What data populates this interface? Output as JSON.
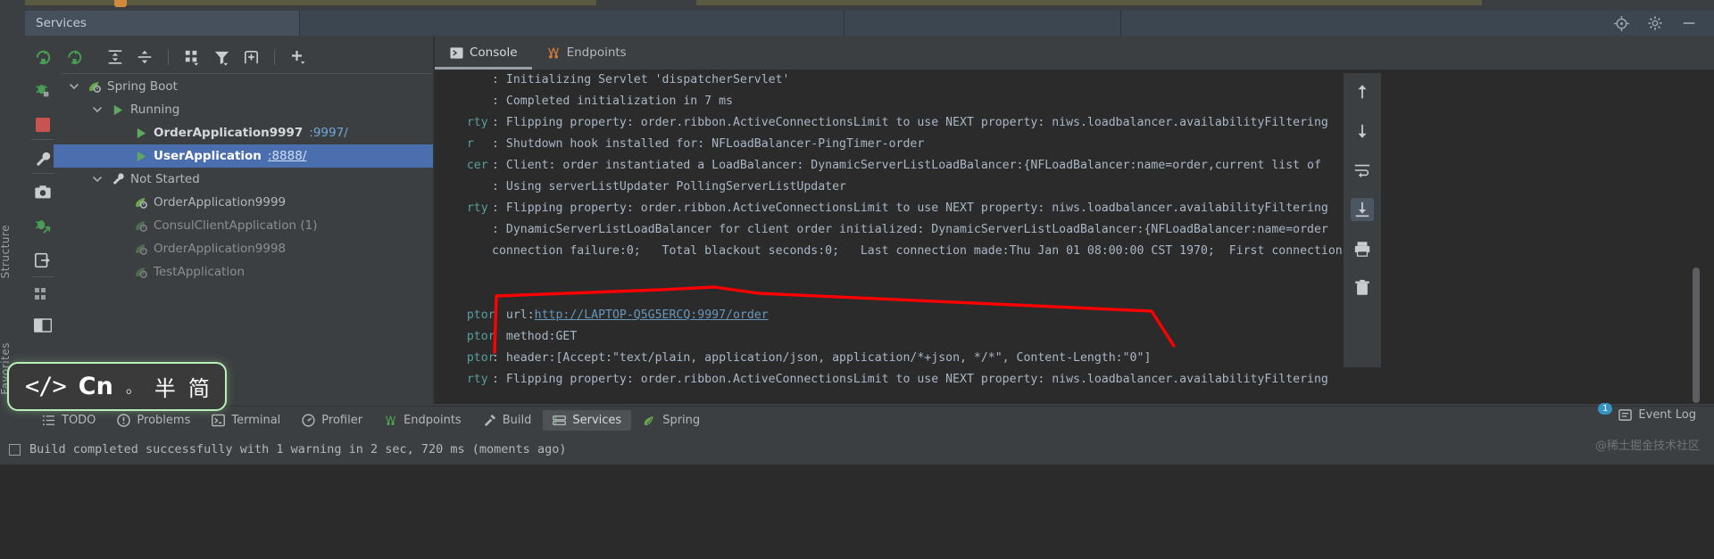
{
  "window": {
    "tab_title": "Services",
    "titlebar_icons": [
      "target-icon",
      "gear-icon",
      "minimize-icon"
    ]
  },
  "left_rail": {
    "structure_label": "Structure",
    "favorites_label": "Favorites"
  },
  "tree_toolbar": {
    "buttons": [
      {
        "name": "rerun-icon",
        "tooltip": "Rerun"
      },
      {
        "name": "expand-all-icon",
        "tooltip": "Expand All"
      },
      {
        "name": "collapse-all-icon",
        "tooltip": "Collapse All"
      },
      {
        "name": "group-by-icon",
        "tooltip": "Group By"
      },
      {
        "name": "filter-icon",
        "tooltip": "Filter"
      },
      {
        "name": "add-tab-icon",
        "tooltip": "Add Tab"
      },
      {
        "name": "add-icon",
        "tooltip": "Add Service"
      }
    ]
  },
  "side_icons": [
    {
      "name": "rerun-icon"
    },
    {
      "name": "debug-icon"
    },
    {
      "name": "stop-icon"
    },
    {
      "name": "settings-wrench-icon"
    },
    {
      "name": "camera-icon"
    },
    {
      "name": "debug-attach-icon"
    },
    {
      "name": "export-icon"
    },
    {
      "name": "layout-icon"
    },
    {
      "name": "window-icon"
    }
  ],
  "tree": {
    "nodes": [
      {
        "label": "Spring Boot",
        "icon": "spring-leaf-icon",
        "indent": 0,
        "expanded": true,
        "selected": false,
        "bold": false,
        "port": ""
      },
      {
        "label": "Running",
        "icon": "run-green-triangle-icon",
        "indent": 1,
        "expanded": true,
        "selected": false,
        "bold": false,
        "port": ""
      },
      {
        "label": "OrderApplication9997",
        "icon": "run-green-triangle-icon",
        "indent": 2,
        "expanded": null,
        "selected": false,
        "bold": true,
        "port": ":9997/"
      },
      {
        "label": "UserApplication",
        "icon": "run-green-triangle-icon",
        "indent": 2,
        "expanded": null,
        "selected": true,
        "bold": true,
        "port": ":8888/"
      },
      {
        "label": "Not Started",
        "icon": "wrench-icon",
        "indent": 1,
        "expanded": true,
        "selected": false,
        "bold": false,
        "port": ""
      },
      {
        "label": "OrderApplication9999",
        "icon": "spring-leaf-icon",
        "indent": 2,
        "expanded": null,
        "selected": false,
        "bold": false,
        "port": ""
      },
      {
        "label": "ConsulClientApplication (1)",
        "icon": "spring-leaf-dim-icon",
        "indent": 2,
        "expanded": null,
        "selected": false,
        "bold": false,
        "port": ""
      },
      {
        "label": "OrderApplication9998",
        "icon": "spring-leaf-dim-icon",
        "indent": 2,
        "expanded": null,
        "selected": false,
        "bold": false,
        "port": ""
      },
      {
        "label": "TestApplication",
        "icon": "spring-leaf-dim-icon",
        "indent": 2,
        "expanded": null,
        "selected": false,
        "bold": false,
        "port": ""
      }
    ]
  },
  "console": {
    "tabs": [
      {
        "label": "Console",
        "icon": "console-icon",
        "active": true
      },
      {
        "label": "Endpoints",
        "icon": "endpoints-icon",
        "active": false
      }
    ],
    "lines": [
      {
        "prefix": "",
        "text": ": Initializing Servlet 'dispatcherServlet'"
      },
      {
        "prefix": "",
        "text": ": Completed initialization in 7 ms"
      },
      {
        "prefix": "rty",
        "text": ": Flipping property: order.ribbon.ActiveConnectionsLimit to use NEXT property: niws.loadbalancer.availabilityFiltering"
      },
      {
        "prefix": "r",
        "text": ": Shutdown hook installed for: NFLoadBalancer-PingTimer-order"
      },
      {
        "prefix": "cer",
        "text": ": Client: order instantiated a LoadBalancer: DynamicServerListLoadBalancer:{NFLoadBalancer:name=order,current list of"
      },
      {
        "prefix": "",
        "text": ": Using serverListUpdater PollingServerListUpdater"
      },
      {
        "prefix": "rty",
        "text": ": Flipping property: order.ribbon.ActiveConnectionsLimit to use NEXT property: niws.loadbalancer.availabilityFiltering"
      },
      {
        "prefix": "",
        "text": ": DynamicServerListLoadBalancer for client order initialized: DynamicServerListLoadBalancer:{NFLoadBalancer:name=order"
      },
      {
        "prefix": "",
        "text": "connection failure:0;   Total blackout seconds:0;   Last connection made:Thu Jan 01 08:00:00 CST 1970;  First connection"
      },
      {
        "prefix": "",
        "text": ""
      },
      {
        "prefix": "",
        "text": ""
      },
      {
        "prefix": "ptor",
        "text": ": url:",
        "link": "http://LAPTOP-Q5G5ERCQ:9997/order"
      },
      {
        "prefix": "ptor",
        "text": ": method:GET"
      },
      {
        "prefix": "ptor",
        "text": ": header:[Accept:\"text/plain, application/json, application/*+json, */*\", Content-Length:\"0\"]"
      },
      {
        "prefix": "rty",
        "text": ": Flipping property: order.ribbon.ActiveConnectionsLimit to use NEXT property: niws.loadbalancer.availabilityFiltering"
      }
    ]
  },
  "console_actions": [
    {
      "name": "scroll-up-icon"
    },
    {
      "name": "scroll-down-icon"
    },
    {
      "name": "soft-wrap-icon"
    },
    {
      "name": "scroll-to-end-icon",
      "active": true
    },
    {
      "name": "print-icon"
    },
    {
      "name": "trash-icon"
    }
  ],
  "bottom_bar": {
    "items": [
      {
        "label": "TODO",
        "icon": "todo-list-icon",
        "active": false
      },
      {
        "label": "Problems",
        "icon": "problems-icon",
        "active": false
      },
      {
        "label": "Terminal",
        "icon": "terminal-icon",
        "active": false
      },
      {
        "label": "Profiler",
        "icon": "profiler-icon",
        "active": false
      },
      {
        "label": "Endpoints",
        "icon": "endpoints-icon",
        "active": false
      },
      {
        "label": "Build",
        "icon": "build-hammer-icon",
        "active": false
      },
      {
        "label": "Services",
        "icon": "services-icon",
        "active": true
      },
      {
        "label": "Spring",
        "icon": "spring-leaf-icon",
        "active": false
      }
    ],
    "event_log": {
      "label": "Event Log",
      "badge": "1",
      "icon": "event-log-icon"
    }
  },
  "status_bar": {
    "text": "Build completed successfully with 1 warning in 2 sec, 720 ms (moments ago)",
    "icon": "build-status-icon",
    "watermark": "@稀土掘金技术社区"
  },
  "ime_overlay": {
    "code_symbol": "</>",
    "language": "Cn",
    "separator": "。",
    "width_mode": "半",
    "script_mode": "简"
  },
  "colors": {
    "accent_selection": "#4b6eaf",
    "link": "#6897bb",
    "annotation_red": "#fe0000",
    "console_bg": "#2b2b2b",
    "panel_bg": "#3c3f41",
    "green": "#499c54",
    "teal_log": "#5a9e9e"
  }
}
